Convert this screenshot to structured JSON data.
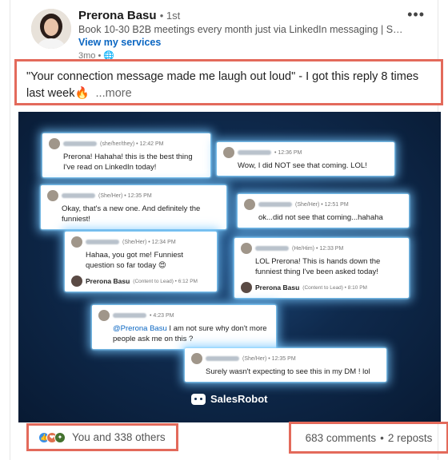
{
  "post": {
    "author": "Prerona Basu",
    "degree": "• 1st",
    "headline": "Book 10-30 B2B meetings every month just via LinkedIn messaging | Sen...",
    "services_link": "View my services",
    "timestamp": "3mo •",
    "caption": "\"Your connection message made me laugh out loud\" - I got this reply 8 times last week🔥",
    "more_label": "...more"
  },
  "image": {
    "brand": "SalesRobot",
    "cards": [
      {
        "meta": "(she/her/they) • 12:42 PM",
        "text": "Prerona! Hahaha! this is the best thing I've read on LinkedIn today!"
      },
      {
        "meta": "• 12:36 PM",
        "text": "Wow, I did NOT see that coming. LOL!"
      },
      {
        "meta": "(She/Her) • 12:35 PM",
        "text": "Okay, that's a new one. And definitely the funniest!"
      },
      {
        "meta": "(She/Her) • 12:51 PM",
        "text": "ok...did not see that coming...hahaha"
      },
      {
        "meta": "(She/Her) • 12:34 PM",
        "text": "Hahaa, you got me! Funniest question so far today 😍",
        "reply_name": "Prerona Basu",
        "reply_sub": "(Content to Lead) • 6:12 PM"
      },
      {
        "meta": "(He/Him) • 12:33 PM",
        "text": "LOL Prerona! This is hands down the funniest thing I've been asked today!",
        "reply_name": "Prerona Basu",
        "reply_sub": "(Content to Lead) • 8:10 PM"
      },
      {
        "meta": "• 4:23 PM",
        "mention": "@Prerona Basu",
        "text": " I am not sure why don't more people ask me on this ?"
      },
      {
        "meta": "(She/Her) • 12:35 PM",
        "text": "Surely wasn't expecting to see this in my DM ! lol"
      }
    ]
  },
  "footer": {
    "reactions_text": "You and 338 others",
    "comments": "683 comments",
    "separator": "•",
    "reposts": "2 reposts"
  },
  "icons": [
    "like-icon",
    "love-icon",
    "celebrate-icon",
    "more-options-icon",
    "globe-icon"
  ],
  "colors": {
    "link": "#0a66c2",
    "highlight": "#e36a5b",
    "image_bg": "#0f2a4d"
  }
}
